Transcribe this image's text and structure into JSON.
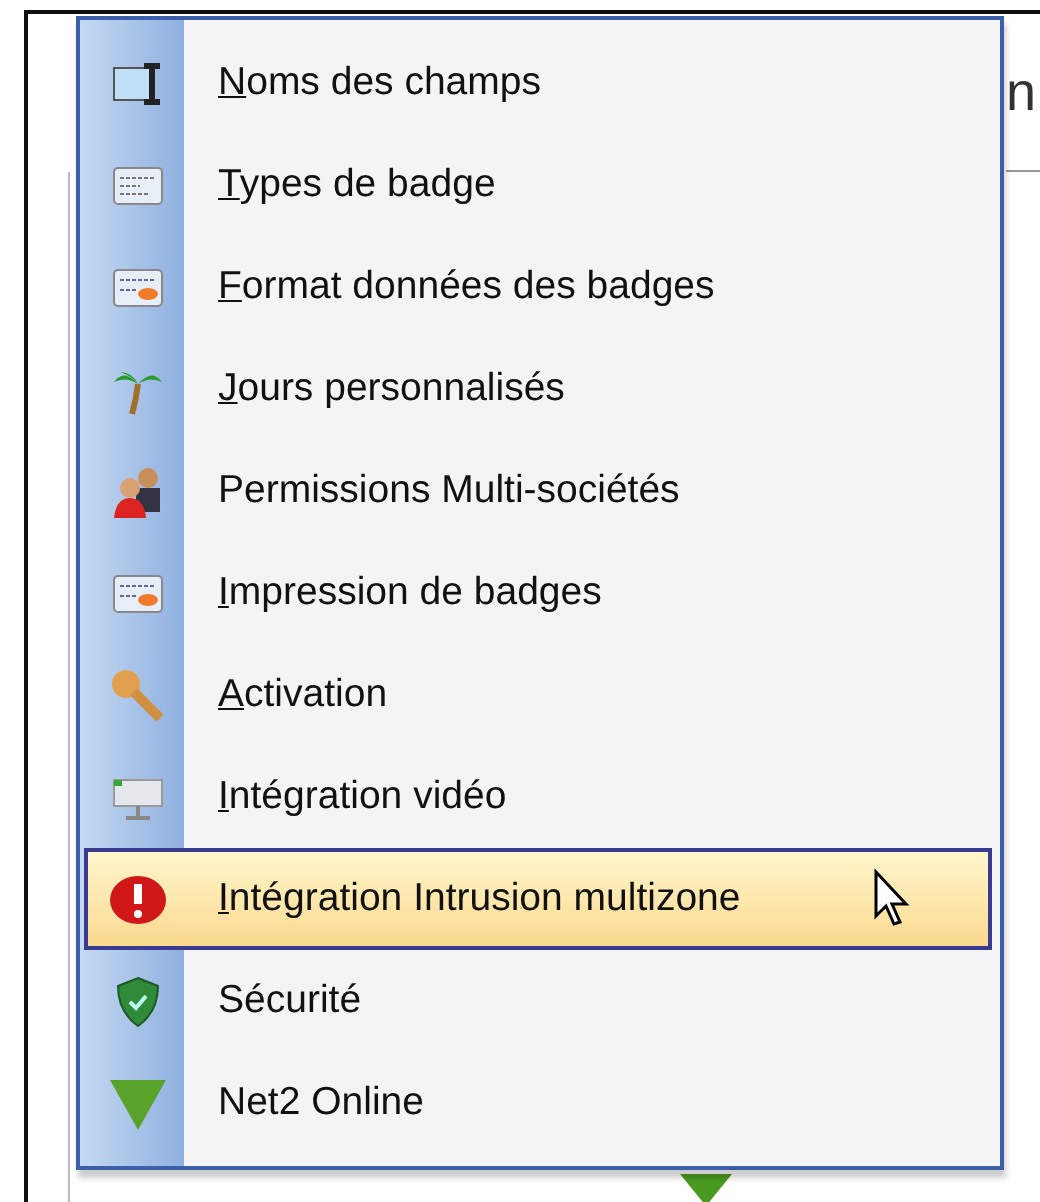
{
  "background_window": {
    "title_fragment": "n"
  },
  "menu": {
    "items": [
      {
        "label": "Noms des champs",
        "underline_first": true,
        "selected": false
      },
      {
        "label": "Types de badge",
        "underline_first": true,
        "selected": false
      },
      {
        "label": "Format données des badges",
        "underline_first": true,
        "selected": false
      },
      {
        "label": "Jours personnalisés",
        "underline_first": true,
        "selected": false
      },
      {
        "label": "Permissions Multi-sociétés",
        "underline_first": false,
        "selected": false
      },
      {
        "label": "Impression de badges",
        "underline_first": true,
        "selected": false
      },
      {
        "label": "Activation",
        "underline_first": true,
        "selected": false
      },
      {
        "label": "Intégration vidéo",
        "underline_first": true,
        "selected": false
      },
      {
        "label": "Intégration Intrusion multizone",
        "underline_first": true,
        "selected": true
      },
      {
        "label": "Sécurité",
        "underline_first": false,
        "selected": false
      },
      {
        "label": "Net2 Online",
        "underline_first": false,
        "selected": false
      }
    ]
  }
}
